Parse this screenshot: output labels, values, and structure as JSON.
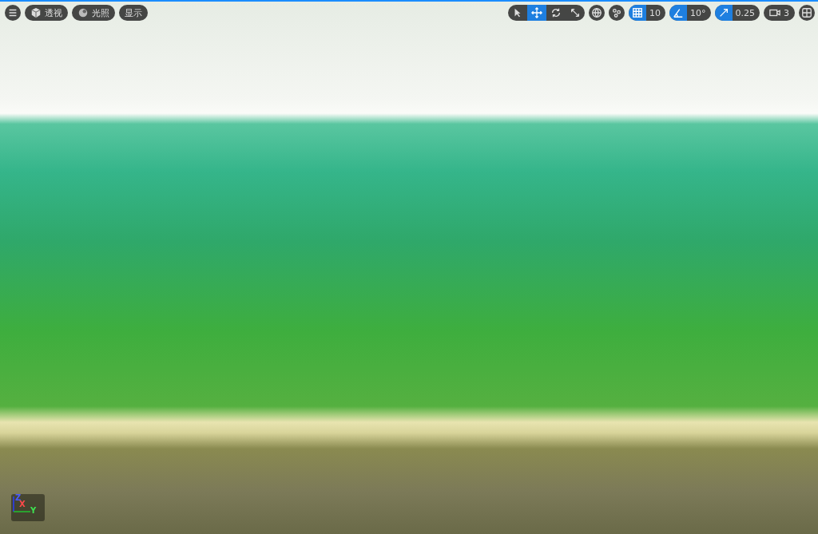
{
  "left_toolbar": {
    "buttons": [
      {
        "kind": "perspective",
        "label": "透视"
      },
      {
        "kind": "lighting",
        "label": "光照"
      },
      {
        "kind": "show",
        "label": "显示"
      }
    ]
  },
  "right_toolbar": {
    "transform_tools": [
      {
        "kind": "select",
        "selected": false
      },
      {
        "kind": "move",
        "selected": true
      },
      {
        "kind": "rotate",
        "selected": false
      },
      {
        "kind": "scale",
        "selected": false
      }
    ],
    "snaps": [
      {
        "kind": "grid",
        "on": true,
        "value": "10"
      },
      {
        "kind": "rotation",
        "on": true,
        "value": "10°"
      },
      {
        "kind": "scale",
        "on": true,
        "value": "0.25"
      }
    ],
    "camera_speed": "3"
  },
  "axis_gizmo": [
    {
      "kind": "z",
      "label": "Z"
    },
    {
      "kind": "x",
      "label": "X"
    },
    {
      "kind": "y",
      "label": "Y"
    }
  ]
}
